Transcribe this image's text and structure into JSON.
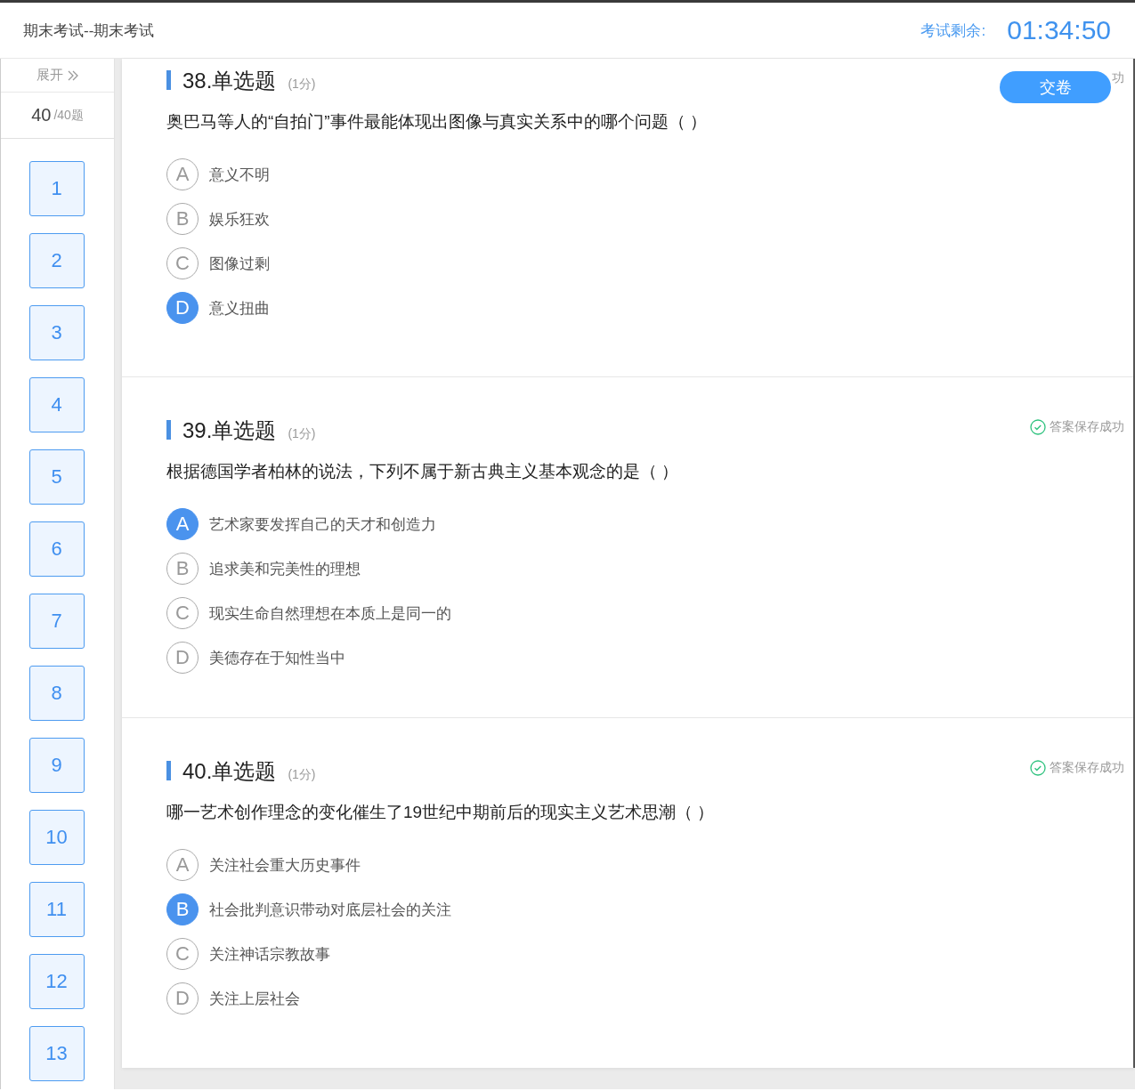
{
  "header": {
    "title": "期末考试--期末考试",
    "timer_label": "考试剩余:",
    "timer": "01:34:50"
  },
  "sidebar": {
    "expand": "展开",
    "progress_current": "40",
    "progress_total": "/40题",
    "numbers": [
      {
        "label": "1"
      },
      {
        "label": "2"
      },
      {
        "label": "3"
      },
      {
        "label": "4"
      },
      {
        "label": "5"
      },
      {
        "label": "6"
      },
      {
        "label": "7"
      },
      {
        "label": "8"
      },
      {
        "label": "9"
      },
      {
        "label": "10"
      },
      {
        "label": "11"
      },
      {
        "label": "12"
      },
      {
        "label": "13"
      }
    ]
  },
  "submit_button": "交卷",
  "questions": [
    {
      "title": "38.单选题",
      "score": "(1分)",
      "save_status": "功",
      "saved_icon": false,
      "text": "奥巴马等人的“自拍门”事件最能体现出图像与真实关系中的哪个问题（ ）",
      "options": [
        {
          "letter": "A",
          "text": "意义不明",
          "selected": false
        },
        {
          "letter": "B",
          "text": "娱乐狂欢",
          "selected": false
        },
        {
          "letter": "C",
          "text": "图像过剩",
          "selected": false
        },
        {
          "letter": "D",
          "text": "意义扭曲",
          "selected": true
        }
      ]
    },
    {
      "title": "39.单选题",
      "score": "(1分)",
      "save_status": "答案保存成功",
      "saved_icon": true,
      "text": "根据德国学者柏林的说法，下列不属于新古典主义基本观念的是（ ）",
      "options": [
        {
          "letter": "A",
          "text": "艺术家要发挥自己的天才和创造力",
          "selected": true
        },
        {
          "letter": "B",
          "text": "追求美和完美性的理想",
          "selected": false
        },
        {
          "letter": "C",
          "text": "现实生命自然理想在本质上是同一的",
          "selected": false
        },
        {
          "letter": "D",
          "text": "美德存在于知性当中",
          "selected": false
        }
      ]
    },
    {
      "title": "40.单选题",
      "score": "(1分)",
      "save_status": "答案保存成功",
      "saved_icon": true,
      "text": "哪一艺术创作理念的变化催生了19世纪中期前后的现实主义艺术思潮（ ）",
      "options": [
        {
          "letter": "A",
          "text": "关注社会重大历史事件",
          "selected": false
        },
        {
          "letter": "B",
          "text": "社会批判意识带动对底层社会的关注",
          "selected": true
        },
        {
          "letter": "C",
          "text": "关注神话宗教故事",
          "selected": false
        },
        {
          "letter": "D",
          "text": "关注上层社会",
          "selected": false
        }
      ]
    }
  ]
}
